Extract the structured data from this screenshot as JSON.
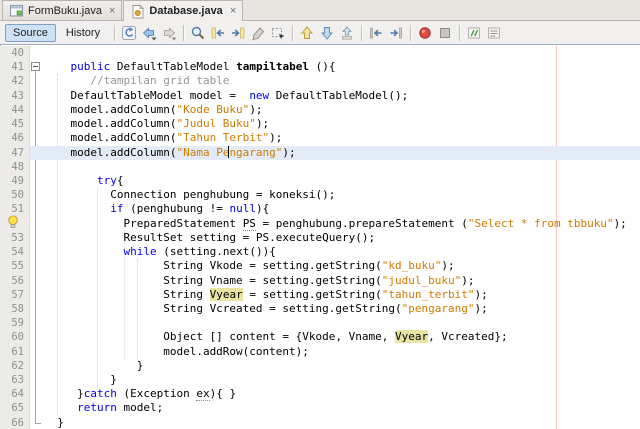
{
  "tabs": [
    {
      "label": "FormBuku.java",
      "icon": "form",
      "active": false,
      "close": "×"
    },
    {
      "label": "Database.java",
      "icon": "java-class",
      "active": true,
      "close": "×"
    }
  ],
  "toolbar": {
    "source_label": "Source",
    "history_label": "History",
    "groups": [
      [
        "last-edit",
        "back",
        "forward"
      ],
      [
        "find-selection",
        "find-previous",
        "find-next",
        "toggle-highlight",
        "rectangular-selection"
      ],
      [
        "previous-bookmark",
        "next-bookmark",
        "toggle-bookmark"
      ],
      [
        "shift-line-left",
        "shift-line-right"
      ],
      [
        "start-macro-recording",
        "stop-macro-recording"
      ],
      [
        "comment",
        "uncomment"
      ]
    ]
  },
  "colors": {
    "keyword": "#0000e6",
    "string": "#ce7b00",
    "comment": "#969696",
    "occurrence_highlight": "#e7e4a4",
    "current_line": "#e3ebf6",
    "margin_line": "#f6c3c3",
    "gutter_bg": "#ecebe8"
  },
  "editor": {
    "fold": {
      "start_line": "41",
      "end_line": "66",
      "state": "expanded"
    },
    "lines": [
      {
        "n": "40",
        "t": []
      },
      {
        "n": "41",
        "t": [
          [
            "p",
            "    "
          ],
          [
            "k",
            "public"
          ],
          [
            "p",
            " DefaultTableModel "
          ],
          [
            "d",
            "tampiltabel"
          ],
          [
            "p",
            " (){"
          ]
        ]
      },
      {
        "n": "42",
        "t": [
          [
            "p",
            "       "
          ],
          [
            "c",
            "//tampilan grid table"
          ]
        ]
      },
      {
        "n": "43",
        "t": [
          [
            "p",
            "    DefaultTableModel model =  "
          ],
          [
            "k",
            "new"
          ],
          [
            "p",
            " DefaultTableModel();"
          ]
        ]
      },
      {
        "n": "44",
        "t": [
          [
            "p",
            "    model.addColumn("
          ],
          [
            "s",
            "\"Kode Buku\""
          ],
          [
            "p",
            ");"
          ]
        ]
      },
      {
        "n": "45",
        "t": [
          [
            "p",
            "    model.addColumn("
          ],
          [
            "s",
            "\"Judul Buku\""
          ],
          [
            "p",
            ");"
          ]
        ]
      },
      {
        "n": "46",
        "t": [
          [
            "p",
            "    model.addColumn("
          ],
          [
            "s",
            "\"Tahun Terbit\""
          ],
          [
            "p",
            ");"
          ]
        ]
      },
      {
        "n": "47",
        "cur": true,
        "t": [
          [
            "p",
            "    model.addColumn("
          ],
          [
            "s",
            "\"Nama Pe"
          ],
          [
            "caret",
            ""
          ],
          [
            "s",
            "ngarang\""
          ],
          [
            "p",
            ");"
          ]
        ]
      },
      {
        "n": "48",
        "t": []
      },
      {
        "n": "49",
        "t": [
          [
            "p",
            "        "
          ],
          [
            "k",
            "try"
          ],
          [
            "p",
            "{"
          ]
        ]
      },
      {
        "n": "50",
        "t": [
          [
            "p",
            "          Connection penghubung = koneksi();"
          ]
        ]
      },
      {
        "n": "51",
        "t": [
          [
            "p",
            "          "
          ],
          [
            "k",
            "if"
          ],
          [
            "p",
            " (penghubung != "
          ],
          [
            "k",
            "null"
          ],
          [
            "p",
            "){"
          ]
        ]
      },
      {
        "n": "52",
        "glyph": "bulb",
        "t": [
          [
            "p",
            "            PreparedStatement "
          ],
          [
            "u",
            "PS"
          ],
          [
            "p",
            " = penghubung.prepareStatement ("
          ],
          [
            "s",
            "\"Select * from tbbuku\""
          ],
          [
            "p",
            ");"
          ]
        ]
      },
      {
        "n": "53",
        "t": [
          [
            "p",
            "            ResultSet setting = PS.executeQuery();"
          ]
        ]
      },
      {
        "n": "54",
        "t": [
          [
            "p",
            "            "
          ],
          [
            "k",
            "while"
          ],
          [
            "p",
            " (setting.next()){"
          ]
        ]
      },
      {
        "n": "55",
        "t": [
          [
            "p",
            "                  String Vkode = setting.getString("
          ],
          [
            "s",
            "\"kd_buku\""
          ],
          [
            "p",
            ");"
          ]
        ]
      },
      {
        "n": "56",
        "t": [
          [
            "p",
            "                  String Vname = setting.getString("
          ],
          [
            "s",
            "\"judul_buku\""
          ],
          [
            "p",
            ");"
          ]
        ]
      },
      {
        "n": "57",
        "t": [
          [
            "p",
            "                  String "
          ],
          [
            "o",
            "Vyear"
          ],
          [
            "p",
            " = setting.getString("
          ],
          [
            "s",
            "\"tahun_terbit\""
          ],
          [
            "p",
            ");"
          ]
        ]
      },
      {
        "n": "58",
        "t": [
          [
            "p",
            "                  String Vcreated = setting.getString("
          ],
          [
            "s",
            "\"pengarang\""
          ],
          [
            "p",
            ");"
          ]
        ]
      },
      {
        "n": "59",
        "t": []
      },
      {
        "n": "60",
        "t": [
          [
            "p",
            "                  Object [] content = {Vkode, Vname, "
          ],
          [
            "o",
            "Vyear"
          ],
          [
            "p",
            ", Vcreated};"
          ]
        ]
      },
      {
        "n": "61",
        "t": [
          [
            "p",
            "                  model.addRow(content);"
          ]
        ]
      },
      {
        "n": "62",
        "t": [
          [
            "p",
            "              }"
          ]
        ]
      },
      {
        "n": "63",
        "t": [
          [
            "p",
            "          }"
          ]
        ]
      },
      {
        "n": "64",
        "t": [
          [
            "p",
            "     }"
          ],
          [
            "k",
            "catch"
          ],
          [
            "p",
            " (Exception "
          ],
          [
            "u",
            "ex"
          ],
          [
            "p",
            "){ }"
          ]
        ]
      },
      {
        "n": "65",
        "t": [
          [
            "p",
            "     "
          ],
          [
            "k",
            "return"
          ],
          [
            "p",
            " model;"
          ]
        ]
      },
      {
        "n": "66",
        "t": [
          [
            "p",
            "  }"
          ]
        ]
      }
    ]
  }
}
